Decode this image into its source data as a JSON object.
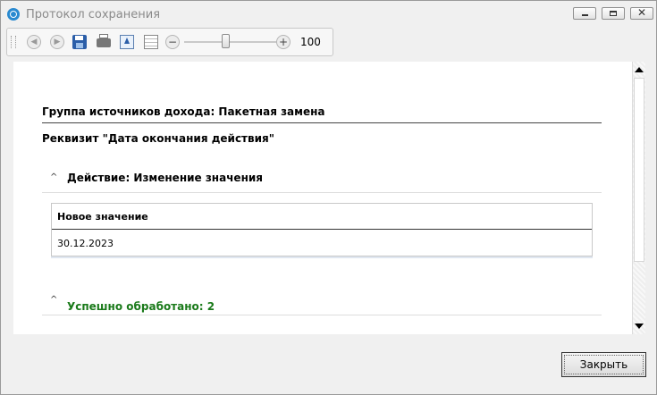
{
  "window": {
    "title": "Протокол сохранения"
  },
  "toolbar": {
    "icons": [
      "back-icon",
      "forward-icon",
      "save-icon",
      "print-icon",
      "export-icon",
      "grid-icon",
      "zoom-out-icon",
      "zoom-in-icon"
    ],
    "zoom_value": "100",
    "zoom_level_percent": 100
  },
  "report": {
    "group_heading": "Группа источников дохода: Пакетная замена",
    "attribute_heading": "Реквизит \"Дата окончания действия\"",
    "action_heading": "Действие: Изменение значения",
    "table": {
      "column_header": "Новое значение",
      "value": "30.12.2023"
    },
    "success_text": "Успешно обработано: 2"
  },
  "colors": {
    "success": "#1a7a1a",
    "accent": "#2b5ea8"
  },
  "footer": {
    "close_label": "Закрыть"
  }
}
